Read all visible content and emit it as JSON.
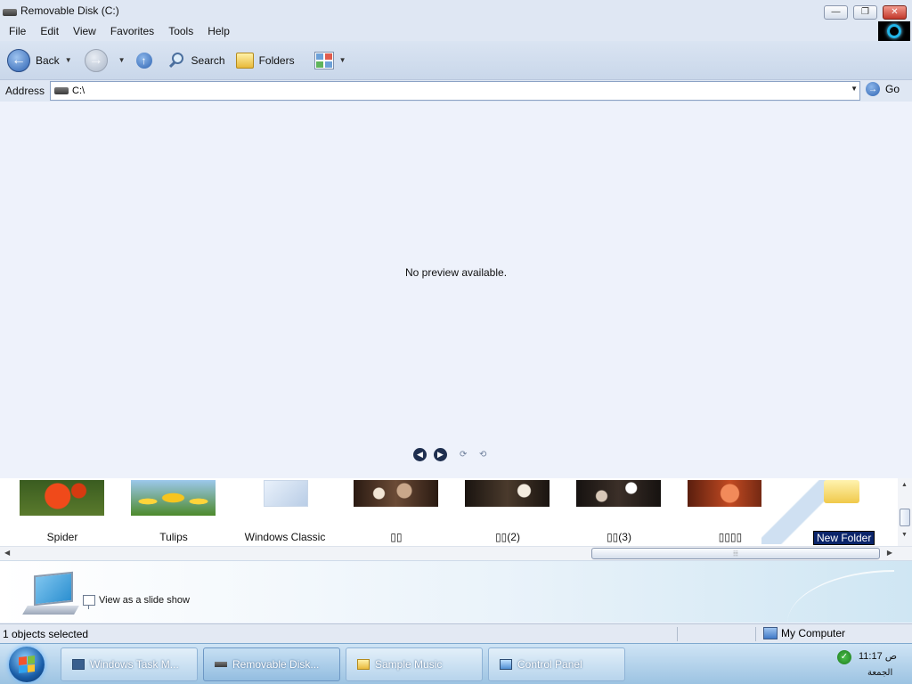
{
  "window": {
    "title": "Removable Disk (C:)",
    "controls": {
      "minimize": "—",
      "restore": "❐",
      "close": "✕"
    }
  },
  "menu": [
    "File",
    "Edit",
    "View",
    "Favorites",
    "Tools",
    "Help"
  ],
  "toolbar": {
    "back": "Back",
    "search": "Search",
    "folders": "Folders"
  },
  "address": {
    "label": "Address",
    "value": "C:\\",
    "go": "Go"
  },
  "preview": {
    "message": "No preview available."
  },
  "filmstrip": {
    "items": [
      {
        "caption": "Spider"
      },
      {
        "caption": "Tulips"
      },
      {
        "caption": "Windows Classic"
      },
      {
        "caption": "▯▯"
      },
      {
        "caption": "▯▯(2)"
      },
      {
        "caption": "▯▯(3)"
      },
      {
        "caption": "▯▯▯▯"
      },
      {
        "caption": "New Folder"
      }
    ]
  },
  "tasks": {
    "slideshow": "View as a slide show"
  },
  "status": {
    "selection": "1 objects selected",
    "location": "My Computer"
  },
  "taskbar": {
    "items": [
      {
        "label": "Windows Task M..."
      },
      {
        "label": "Removable Disk..."
      },
      {
        "label": "Sample Music"
      },
      {
        "label": "Control Panel"
      }
    ],
    "time": "11:17 ص",
    "day": "الجمعة"
  }
}
